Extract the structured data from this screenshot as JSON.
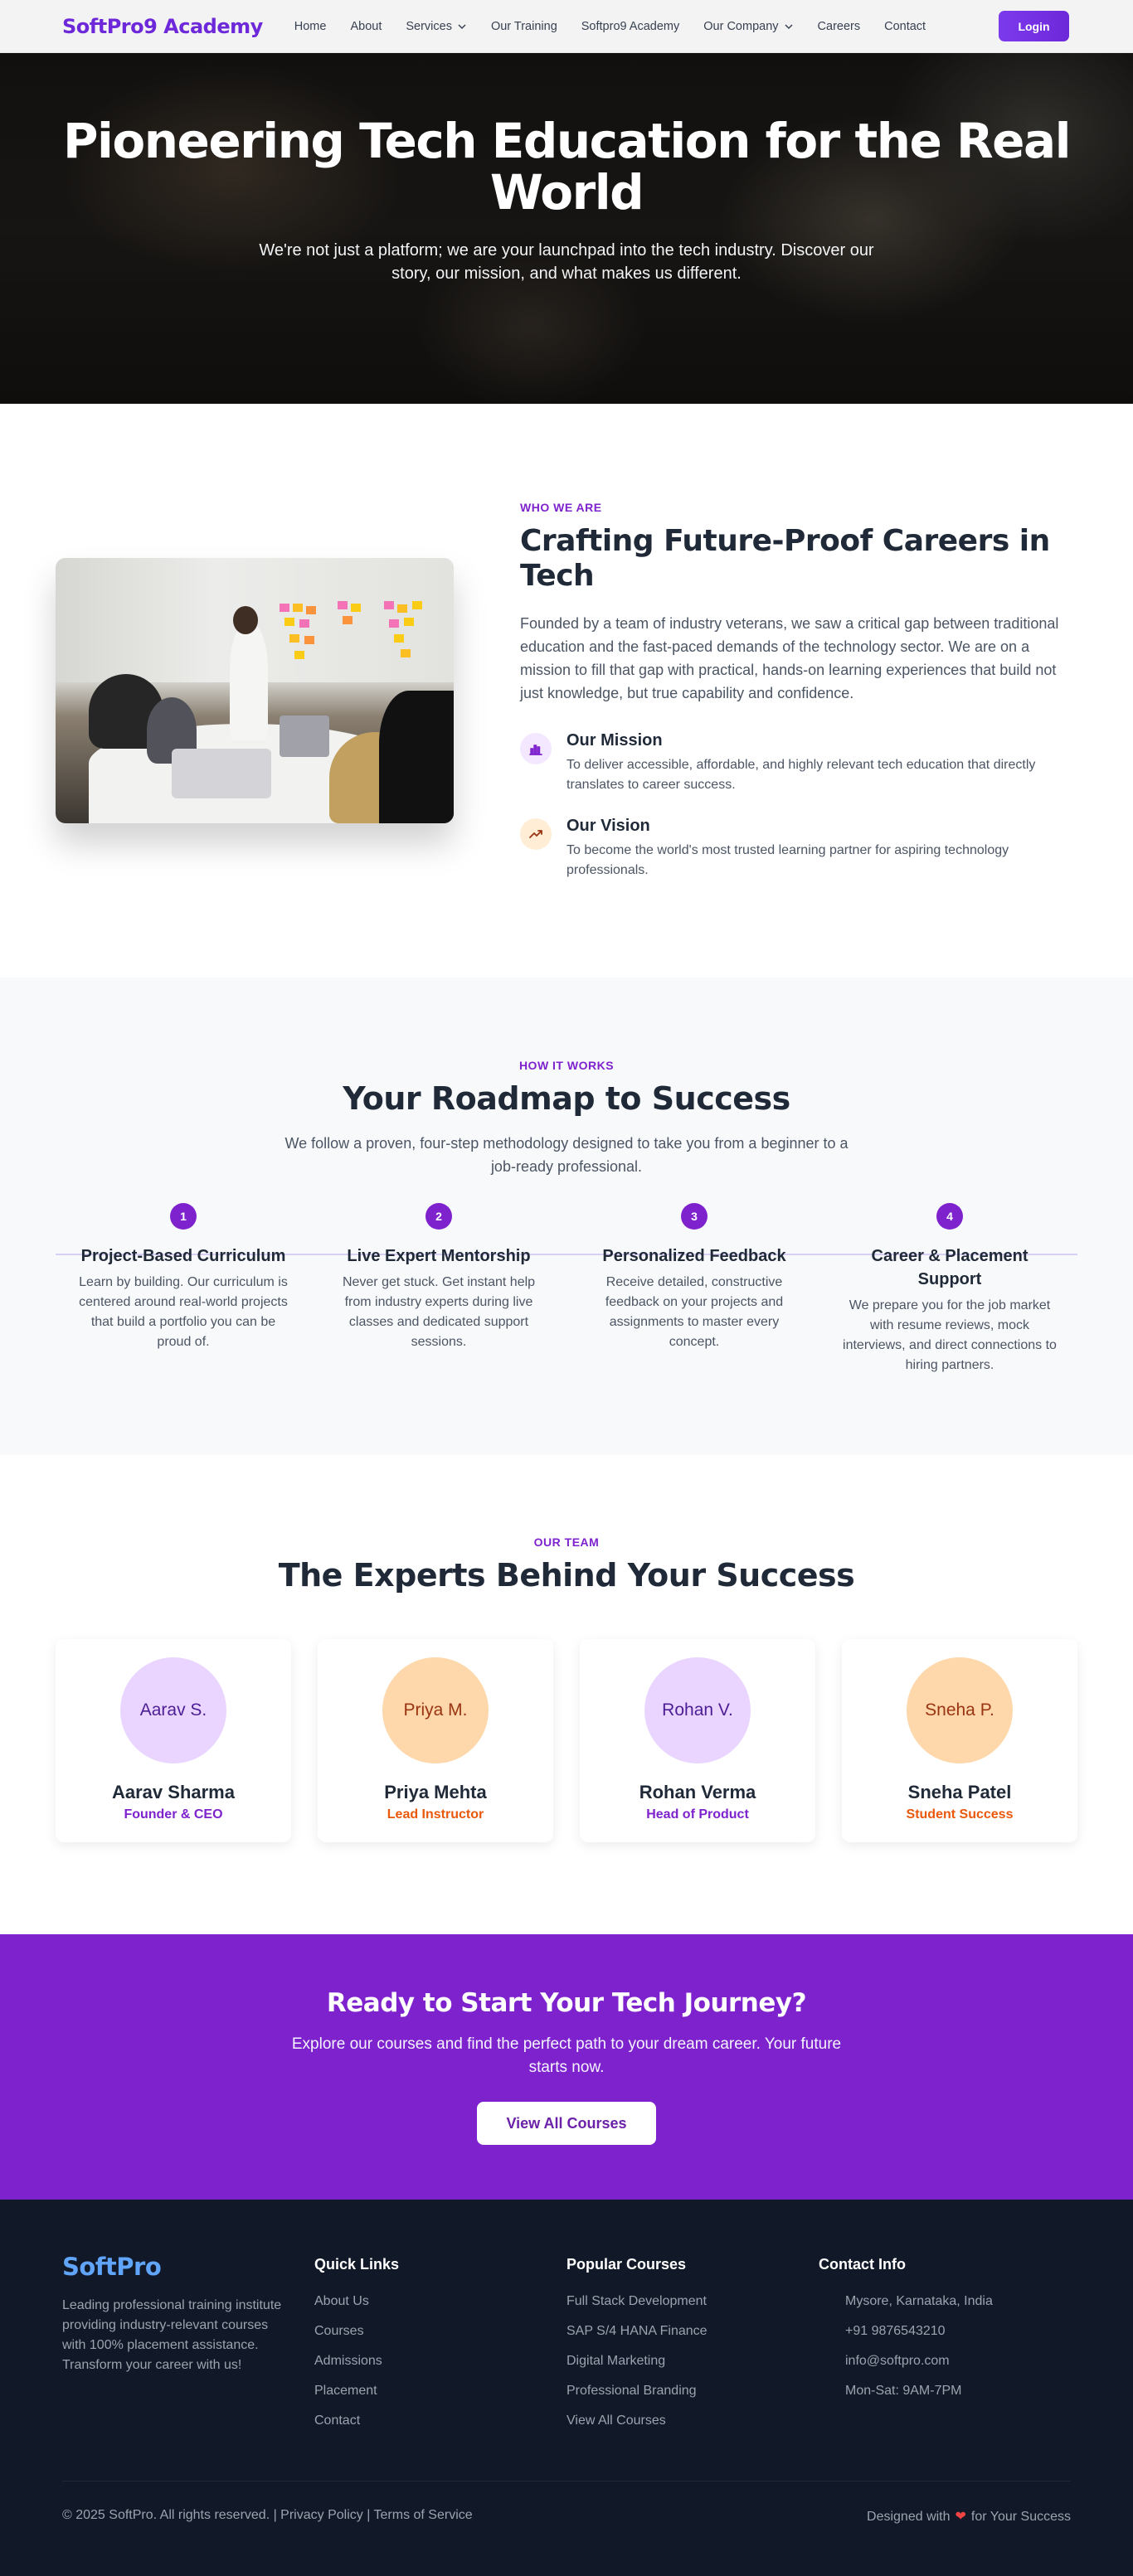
{
  "nav": {
    "brand": "SoftPro9 Academy",
    "links": [
      {
        "label": "Home"
      },
      {
        "label": "About"
      },
      {
        "label": "Services"
      },
      {
        "label": "Our Training"
      },
      {
        "label": "Softpro9 Academy"
      },
      {
        "label": "Our Company"
      },
      {
        "label": "Careers"
      },
      {
        "label": "Contact"
      }
    ],
    "login_label": "Login"
  },
  "hero": {
    "title": "Pioneering Tech Education for the Real World",
    "subtitle": "We're not just a platform; we are your launchpad into the tech industry. Discover our story, our mission, and what makes us different."
  },
  "about": {
    "eyebrow": "WHO WE ARE",
    "title": "Crafting Future-Proof Careers in Tech",
    "lead": "Founded by a team of industry veterans, we saw a critical gap between traditional education and the fast-paced demands of the technology sector. We are on a mission to fill that gap with practical, hands-on learning experiences that build not just knowledge, but true capability and confidence.",
    "mission": {
      "title": "Our Mission",
      "text": "To deliver accessible, affordable, and highly relevant tech education that directly translates to career success."
    },
    "vision": {
      "title": "Our Vision",
      "text": "To become the world's most trusted learning partner for aspiring technology professionals."
    }
  },
  "roadmap": {
    "eyebrow": "HOW IT WORKS",
    "title": "Your Roadmap to Success",
    "subtitle": "We follow a proven, four-step methodology designed to take you from a beginner to a job-ready professional.",
    "steps": [
      {
        "num": "1",
        "title": "Project-Based Curriculum",
        "text": "Learn by building. Our curriculum is centered around real-world projects that build a portfolio you can be proud of."
      },
      {
        "num": "2",
        "title": "Live Expert Mentorship",
        "text": "Never get stuck. Get instant help from industry experts during live classes and dedicated support sessions."
      },
      {
        "num": "3",
        "title": "Personalized Feedback",
        "text": "Receive detailed, constructive feedback on your projects and assignments to master every concept."
      },
      {
        "num": "4",
        "title": "Career & Placement Support",
        "text": "We prepare you for the job market with resume reviews, mock interviews, and direct connections to hiring partners."
      }
    ]
  },
  "team": {
    "eyebrow": "OUR TEAM",
    "title": "The Experts Behind Your Success",
    "members": [
      {
        "avatar": "Aarav S.",
        "name": "Aarav Sharma",
        "role": "Founder & CEO"
      },
      {
        "avatar": "Priya M.",
        "name": "Priya Mehta",
        "role": "Lead Instructor"
      },
      {
        "avatar": "Rohan V.",
        "name": "Rohan Verma",
        "role": "Head of Product"
      },
      {
        "avatar": "Sneha P.",
        "name": "Sneha Patel",
        "role": "Student Success"
      }
    ]
  },
  "cta": {
    "title": "Ready to Start Your Tech Journey?",
    "text": "Explore our courses and find the perfect path to your dream career. Your future starts now.",
    "button": "View All Courses"
  },
  "footer": {
    "brand": "SoftPro",
    "description": "Leading professional training institute providing industry-relevant courses with 100% placement assistance. Transform your career with us!",
    "quick_links": {
      "title": "Quick Links",
      "items": [
        "About Us",
        "Courses",
        "Admissions",
        "Placement",
        "Contact"
      ]
    },
    "popular_courses": {
      "title": "Popular Courses",
      "items": [
        "Full Stack Development",
        "SAP S/4 HANA Finance",
        "Digital Marketing",
        "Professional Branding",
        "View All Courses"
      ]
    },
    "contact": {
      "title": "Contact Info",
      "items": [
        "Mysore, Karnataka, India",
        "+91 9876543210",
        "info@softpro.com",
        "Mon-Sat: 9AM-7PM"
      ]
    },
    "copyright": "© 2025 SoftPro. All rights reserved. | Privacy Policy | Terms of Service",
    "designed_prefix": "Designed with",
    "designed_suffix": "for Your Success"
  },
  "colors": {
    "brand_purple": "#7e22ce",
    "accent_orange": "#ea580c",
    "footer_bg": "#111827",
    "footer_brand": "#60a5fa"
  },
  "icons": {
    "mission": "bar-chart-icon",
    "vision": "trending-up-icon",
    "dropdown": "chevron-down-icon",
    "heart": "heart-icon"
  }
}
